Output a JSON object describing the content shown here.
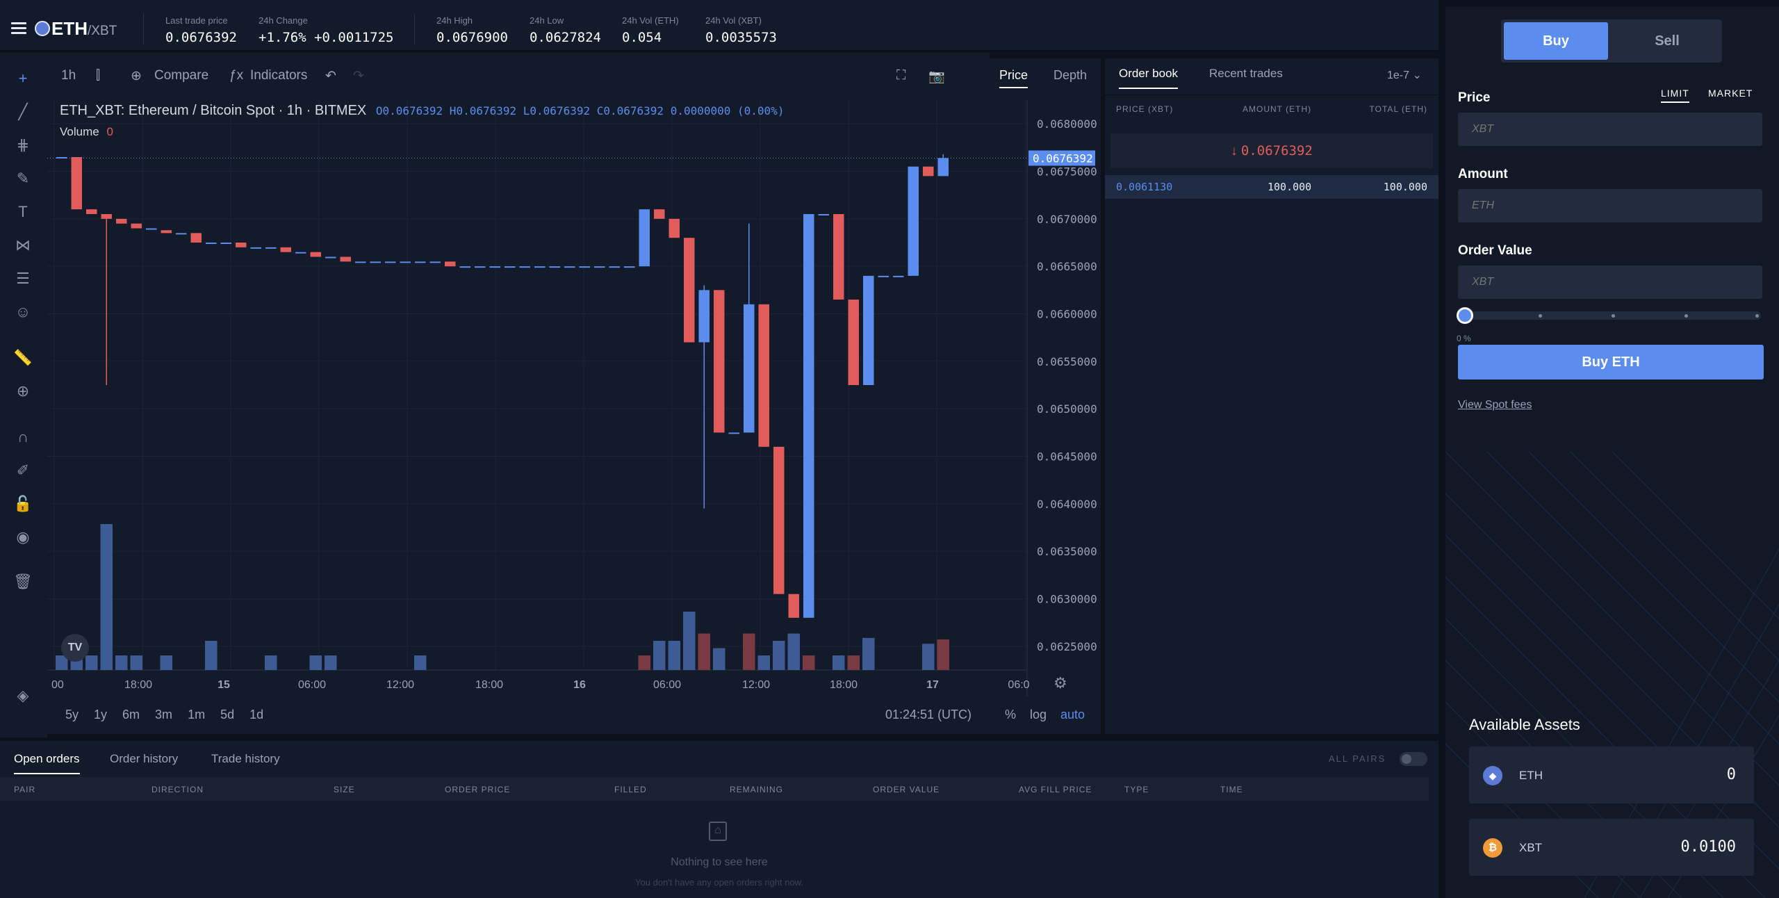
{
  "header": {
    "pair_main": "ETH",
    "pair_sub": "/XBT",
    "stats": [
      {
        "label": "Last trade price",
        "value": "0.0676392",
        "color": "#5b8def"
      },
      {
        "label": "24h Change",
        "value": "+1.76%  +0.0011725",
        "color": "#5b8def"
      },
      {
        "label": "24h High",
        "value": "0.0676900",
        "color": "#ffffff"
      },
      {
        "label": "24h Low",
        "value": "0.0627824",
        "color": "#ffffff"
      },
      {
        "label": "24h Vol (ETH)",
        "value": "0.054",
        "color": "#ffffff"
      },
      {
        "label": "24h Vol (XBT)",
        "value": "0.0035573",
        "color": "#ffffff"
      }
    ]
  },
  "chart_toolbar": {
    "interval": "1h",
    "compare": "Compare",
    "indicators": "Indicators"
  },
  "chart_tabs": {
    "price": "Price",
    "depth": "Depth"
  },
  "chart_legend": {
    "title": "ETH_XBT: Ethereum / Bitcoin Spot · 1h · BITMEX",
    "ohlc": "O0.0676392 H0.0676392 L0.0676392 C0.0676392 0.0000000 (0.00%)",
    "volume_label": "Volume",
    "volume_value": "0"
  },
  "chart_data": {
    "type": "candlestick",
    "y_ticks": [
      "0.0680000",
      "0.0675000",
      "0.0670000",
      "0.0665000",
      "0.0660000",
      "0.0655000",
      "0.0650000",
      "0.0645000",
      "0.0640000",
      "0.0635000",
      "0.0630000",
      "0.0625000"
    ],
    "ylim": [
      0.06225,
      0.06825
    ],
    "x_ticks": [
      "00",
      "18:00",
      "15",
      "06:00",
      "12:00",
      "18:00",
      "16",
      "06:00",
      "12:00",
      "18:00",
      "17",
      "06:0"
    ],
    "last_price_label": "0.0676392",
    "up_color": "#5b8def",
    "down_color": "#e25c5c",
    "candles": [
      {
        "o": 0.06765,
        "h": 0.06765,
        "l": 0.06765,
        "c": 0.06765
      },
      {
        "o": 0.06765,
        "h": 0.06765,
        "l": 0.0671,
        "c": 0.0671
      },
      {
        "o": 0.0671,
        "h": 0.0671,
        "l": 0.06705,
        "c": 0.06705
      },
      {
        "o": 0.06705,
        "h": 0.06705,
        "l": 0.06525,
        "c": 0.067
      },
      {
        "o": 0.067,
        "h": 0.067,
        "l": 0.06695,
        "c": 0.06695
      },
      {
        "o": 0.06695,
        "h": 0.06695,
        "l": 0.0669,
        "c": 0.0669
      },
      {
        "o": 0.0669,
        "h": 0.0669,
        "l": 0.0669,
        "c": 0.0669
      },
      {
        "o": 0.06688,
        "h": 0.06688,
        "l": 0.06685,
        "c": 0.06685
      },
      {
        "o": 0.06685,
        "h": 0.06685,
        "l": 0.06685,
        "c": 0.06685
      },
      {
        "o": 0.06685,
        "h": 0.06685,
        "l": 0.06675,
        "c": 0.06675
      },
      {
        "o": 0.06675,
        "h": 0.06675,
        "l": 0.06675,
        "c": 0.06675
      },
      {
        "o": 0.06675,
        "h": 0.06675,
        "l": 0.06675,
        "c": 0.06675
      },
      {
        "o": 0.06675,
        "h": 0.06675,
        "l": 0.0667,
        "c": 0.0667
      },
      {
        "o": 0.0667,
        "h": 0.0667,
        "l": 0.0667,
        "c": 0.0667
      },
      {
        "o": 0.0667,
        "h": 0.0667,
        "l": 0.0667,
        "c": 0.0667
      },
      {
        "o": 0.0667,
        "h": 0.0667,
        "l": 0.06665,
        "c": 0.06665
      },
      {
        "o": 0.06665,
        "h": 0.06665,
        "l": 0.06665,
        "c": 0.06665
      },
      {
        "o": 0.06665,
        "h": 0.06665,
        "l": 0.0666,
        "c": 0.0666
      },
      {
        "o": 0.0666,
        "h": 0.0666,
        "l": 0.0666,
        "c": 0.0666
      },
      {
        "o": 0.0666,
        "h": 0.0666,
        "l": 0.06655,
        "c": 0.06655
      },
      {
        "o": 0.06655,
        "h": 0.06655,
        "l": 0.06655,
        "c": 0.06655
      },
      {
        "o": 0.06655,
        "h": 0.06655,
        "l": 0.06655,
        "c": 0.06655
      },
      {
        "o": 0.06655,
        "h": 0.06655,
        "l": 0.06655,
        "c": 0.06655
      },
      {
        "o": 0.06655,
        "h": 0.06655,
        "l": 0.06655,
        "c": 0.06655
      },
      {
        "o": 0.06655,
        "h": 0.06655,
        "l": 0.06655,
        "c": 0.06655
      },
      {
        "o": 0.06655,
        "h": 0.06655,
        "l": 0.06655,
        "c": 0.06655
      },
      {
        "o": 0.06655,
        "h": 0.06655,
        "l": 0.0665,
        "c": 0.0665
      },
      {
        "o": 0.0665,
        "h": 0.0665,
        "l": 0.0665,
        "c": 0.0665
      },
      {
        "o": 0.0665,
        "h": 0.0665,
        "l": 0.0665,
        "c": 0.0665
      },
      {
        "o": 0.0665,
        "h": 0.0665,
        "l": 0.0665,
        "c": 0.0665
      },
      {
        "o": 0.0665,
        "h": 0.0665,
        "l": 0.0665,
        "c": 0.0665
      },
      {
        "o": 0.0665,
        "h": 0.0665,
        "l": 0.0665,
        "c": 0.0665
      },
      {
        "o": 0.0665,
        "h": 0.0665,
        "l": 0.0665,
        "c": 0.0665
      },
      {
        "o": 0.0665,
        "h": 0.0665,
        "l": 0.0665,
        "c": 0.0665
      },
      {
        "o": 0.0665,
        "h": 0.0665,
        "l": 0.0665,
        "c": 0.0665
      },
      {
        "o": 0.0665,
        "h": 0.0665,
        "l": 0.0665,
        "c": 0.0665
      },
      {
        "o": 0.0665,
        "h": 0.0665,
        "l": 0.0665,
        "c": 0.0665
      },
      {
        "o": 0.0665,
        "h": 0.0665,
        "l": 0.0665,
        "c": 0.0665
      },
      {
        "o": 0.0665,
        "h": 0.0665,
        "l": 0.0665,
        "c": 0.0665
      },
      {
        "o": 0.0665,
        "h": 0.0671,
        "l": 0.0665,
        "c": 0.0671
      },
      {
        "o": 0.0671,
        "h": 0.0671,
        "l": 0.067,
        "c": 0.067
      },
      {
        "o": 0.067,
        "h": 0.067,
        "l": 0.0668,
        "c": 0.0668
      },
      {
        "o": 0.0668,
        "h": 0.0668,
        "l": 0.0657,
        "c": 0.0657
      },
      {
        "o": 0.0657,
        "h": 0.0663,
        "l": 0.06395,
        "c": 0.06625
      },
      {
        "o": 0.06625,
        "h": 0.06625,
        "l": 0.06475,
        "c": 0.06475
      },
      {
        "o": 0.06475,
        "h": 0.06475,
        "l": 0.06475,
        "c": 0.06475
      },
      {
        "o": 0.06475,
        "h": 0.06695,
        "l": 0.06475,
        "c": 0.0661
      },
      {
        "o": 0.0661,
        "h": 0.0661,
        "l": 0.0646,
        "c": 0.0646
      },
      {
        "o": 0.0646,
        "h": 0.0646,
        "l": 0.06305,
        "c": 0.06305
      },
      {
        "o": 0.06305,
        "h": 0.06305,
        "l": 0.0628,
        "c": 0.0628
      },
      {
        "o": 0.0628,
        "h": 0.06705,
        "l": 0.0628,
        "c": 0.06705
      },
      {
        "o": 0.06705,
        "h": 0.06705,
        "l": 0.06705,
        "c": 0.06705
      },
      {
        "o": 0.06705,
        "h": 0.06705,
        "l": 0.06615,
        "c": 0.06615
      },
      {
        "o": 0.06615,
        "h": 0.06615,
        "l": 0.06525,
        "c": 0.06525
      },
      {
        "o": 0.06525,
        "h": 0.0664,
        "l": 0.06525,
        "c": 0.0664
      },
      {
        "o": 0.0664,
        "h": 0.0664,
        "l": 0.0664,
        "c": 0.0664
      },
      {
        "o": 0.0664,
        "h": 0.0664,
        "l": 0.0664,
        "c": 0.0664
      },
      {
        "o": 0.0664,
        "h": 0.06755,
        "l": 0.0664,
        "c": 0.06755
      },
      {
        "o": 0.06755,
        "h": 0.06755,
        "l": 0.06745,
        "c": 0.06745
      },
      {
        "o": 0.06745,
        "h": 0.06768,
        "l": 0.06745,
        "c": 0.06764
      }
    ],
    "volume_scale_max": 10,
    "volumes": [
      1,
      1,
      1,
      10,
      1,
      1,
      0,
      1,
      0,
      0,
      2,
      0,
      0,
      0,
      1,
      0,
      0,
      1,
      1,
      0,
      0,
      0,
      0,
      0,
      1,
      0,
      0,
      0,
      0,
      0,
      0,
      0,
      0,
      0,
      0,
      0,
      0,
      0,
      0,
      1,
      2,
      2,
      4,
      2.5,
      1.5,
      0,
      2.5,
      1,
      2,
      2.5,
      1,
      0,
      1,
      1,
      2.2,
      0,
      0,
      0,
      1.8,
      2.1
    ],
    "volume_up": [
      true,
      true,
      true,
      true,
      true,
      true,
      true,
      true,
      true,
      true,
      true,
      true,
      true,
      true,
      true,
      true,
      true,
      true,
      true,
      true,
      true,
      true,
      true,
      true,
      true,
      true,
      true,
      true,
      true,
      true,
      true,
      true,
      true,
      true,
      true,
      true,
      true,
      true,
      true,
      false,
      true,
      true,
      true,
      false,
      true,
      true,
      false,
      true,
      true,
      true,
      false,
      true,
      true,
      false,
      true,
      true,
      true,
      true,
      true,
      false
    ]
  },
  "chart_bottom": {
    "ranges": [
      "5y",
      "1y",
      "6m",
      "3m",
      "1m",
      "5d",
      "1d"
    ],
    "time": "01:24:51 (UTC)",
    "pct": "%",
    "log": "log",
    "auto": "auto"
  },
  "orderbook": {
    "tab_book": "Order book",
    "tab_trades": "Recent trades",
    "precision": "1e-7",
    "col_price": "PRICE (XBT)",
    "col_amount": "AMOUNT (ETH)",
    "col_total": "TOTAL (ETH)",
    "last_price": "0.0676392",
    "rows": [
      {
        "price": "0.0061130",
        "amount": "100.000",
        "total": "100.000"
      }
    ]
  },
  "order_form": {
    "buy": "Buy",
    "sell": "Sell",
    "price_label": "Price",
    "limit": "LIMIT",
    "market": "MARKET",
    "price_placeholder": "XBT",
    "amount_label": "Amount",
    "amount_placeholder": "ETH",
    "value_label": "Order Value",
    "value_placeholder": "XBT",
    "slider_pct": "0 %",
    "slider_value": 0,
    "submit": "Buy ETH",
    "fees_link": "View Spot fees"
  },
  "assets": {
    "title": "Available Assets",
    "items": [
      {
        "symbol": "ETH",
        "amount": "0",
        "color": "#5b7bd6"
      },
      {
        "symbol": "XBT",
        "amount": "0.0100",
        "color": "#f09a3a"
      }
    ]
  },
  "orders": {
    "tabs": [
      "Open orders",
      "Order history",
      "Trade history"
    ],
    "all_pairs": "ALL PAIRS",
    "columns": [
      "PAIR",
      "DIRECTION",
      "SIZE",
      "ORDER PRICE",
      "FILLED",
      "REMAINING",
      "ORDER VALUE",
      "AVG FILL PRICE",
      "TYPE",
      "TIME"
    ],
    "empty_title": "Nothing to see here",
    "empty_sub": "You don't have any open orders right now."
  }
}
